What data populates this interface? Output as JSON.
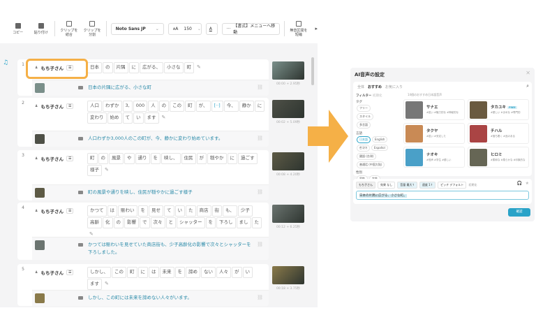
{
  "toolbar": {
    "copy": "コピー",
    "paste": "貼り付け",
    "merge": "クリップを結合",
    "split": "クリップを分割",
    "font": "Noto Sans JP",
    "size": "150",
    "format_menu": "【書式】メニューへ移動",
    "shorten_silence": "無音区間を短縮"
  },
  "rows": [
    {
      "num": "1",
      "speaker": "もち子さん",
      "tokens": [
        "日本",
        "の",
        "片隅",
        "に",
        "広がる、",
        "小さな",
        "町"
      ],
      "subtitle": "日本の片隅に広がる、小さな町",
      "time": "00:00 + 2.95秒"
    },
    {
      "num": "2",
      "speaker": "もち子さん",
      "tokens": [
        "人口",
        "わずか",
        "3,",
        "000",
        "人",
        "の",
        "この",
        "町",
        "が、",
        "[··]",
        "今、",
        "静か",
        "に",
        "変わり",
        "始め",
        "て",
        "い",
        "ます"
      ],
      "subtitle": "人口わずか3,000人のこの町が、今、静かに変わり始めています。",
      "time": "00:02 + 5.09秒"
    },
    {
      "num": "3",
      "speaker": "もち子さん",
      "tokens": [
        "町",
        "の",
        "風景",
        "や",
        "通り",
        "を",
        "映し、",
        "住民",
        "が",
        "穏やか",
        "に",
        "過ごす",
        "様子"
      ],
      "subtitle": "町の風景や通りを映し、住民が穏やかに過ごす様子",
      "time": "00:08 + 4.20秒"
    },
    {
      "num": "4",
      "speaker": "もち子さん",
      "tokens": [
        "かつて",
        "は",
        "賑わい",
        "を",
        "見せ",
        "て",
        "い",
        "た",
        "商店",
        "街",
        "も、",
        "少子",
        "高齢",
        "化",
        "の",
        "影響",
        "で",
        "次々",
        "と",
        "シャッター",
        "を",
        "下ろし",
        "まし",
        "た"
      ],
      "subtitle": "かつては賑わいを見せていた商店街も、少子高齢化の影響で次々とシャッターを下ろしました。",
      "time": "00:12 + 6.25秒"
    },
    {
      "num": "5",
      "speaker": "もち子さん",
      "tokens": [
        "しかし、",
        "この",
        "町",
        "に",
        "は",
        "未来",
        "を",
        "諦め",
        "ない",
        "人々",
        "が",
        "い",
        "ます"
      ],
      "subtitle": "しかし、この町には未来を諦めない人々がいます。",
      "time": "00:18 + 3.75秒"
    }
  ],
  "modal": {
    "title": "AI音声の設定",
    "tabs": [
      "全体",
      "おすすめ",
      "お気に入り"
    ],
    "filter_label": "フィルター",
    "reset": "初期化",
    "tag_label": "タグ",
    "tags": [
      "フリー",
      "スタイル",
      "多言語"
    ],
    "lang_label": "言語",
    "langs": [
      "日本語",
      "English",
      "한국어",
      "Español",
      "國語 (台灣)",
      "普通话 (中国大陆)"
    ],
    "gender_label": "性別",
    "genders": [
      "男性",
      "女性"
    ],
    "count_label": "14個のおすすめ日本語音声",
    "voices": [
      {
        "name": "サナエ",
        "tags": "#若い #魅力的な #神秘的な"
      },
      {
        "name": "タカユキ",
        "badge": "FREE",
        "tags": "#優しい #まめな #専門的"
      },
      {
        "name": "タクヤ",
        "tags": "#若い #安定した"
      },
      {
        "name": "チハル",
        "tags": "#落ち着く #品のある"
      },
      {
        "name": "ナオキ",
        "tags": "#低声 #学生 #優しい"
      },
      {
        "name": "ヒロミ",
        "tags": "#柔和な #柔らかな #印象的な"
      }
    ],
    "voice_sel": "もち子さん",
    "effect": "効果 なし",
    "volume": "音量 最大↑",
    "speed": "速度 1↑",
    "pitch": "ピッチ デフォルト",
    "init": "初期化",
    "preview_text": "日本の片隅に広がる、小さな町。",
    "confirm": "確認"
  },
  "colors": {
    "accent": "#2aa3c8",
    "highlight": "#f5b047"
  }
}
